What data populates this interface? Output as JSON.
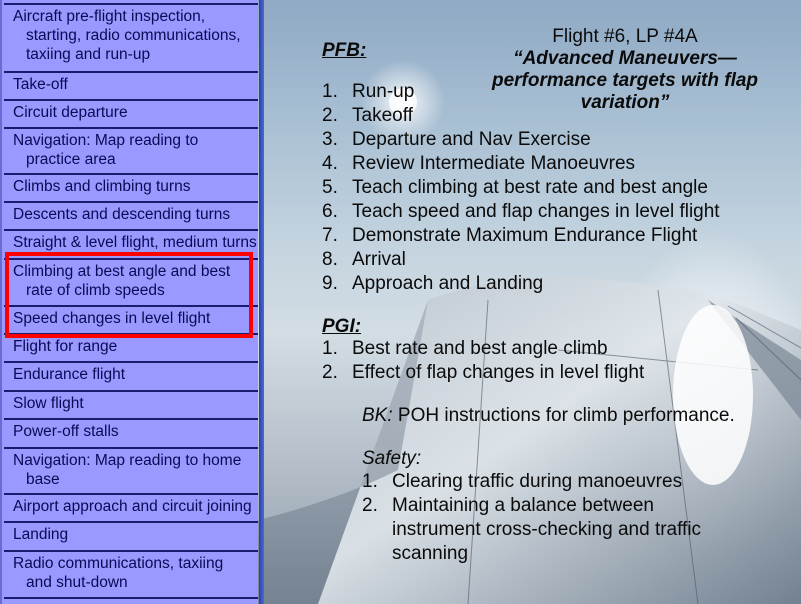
{
  "sidebar": {
    "items": [
      {
        "line1": "Aircraft pre-flight inspection,",
        "line2": "starting, radio communications,",
        "line3": "taxiing and run-up"
      },
      {
        "line1": "Take-off"
      },
      {
        "line1": "Circuit departure"
      },
      {
        "line1": "Navigation:  Map reading to",
        "line2": "practice area"
      },
      {
        "line1": "Climbs and climbing turns"
      },
      {
        "line1": "Descents and descending turns"
      },
      {
        "line1": "Straight & level flight, medium turns"
      },
      {
        "line1": "Climbing at best angle and best",
        "line2": "rate of climb speeds",
        "highlighted": true
      },
      {
        "line1": "Speed changes in level flight",
        "highlighted": true
      },
      {
        "line1": "Flight for range"
      },
      {
        "line1": "Endurance flight"
      },
      {
        "line1": "Slow flight"
      },
      {
        "line1": "Power-off stalls"
      },
      {
        "line1": "Navigation:  Map reading to home",
        "line2": "base"
      },
      {
        "line1": "Airport approach and circuit joining"
      },
      {
        "line1": "Landing"
      },
      {
        "line1": "Radio communications, taxiing",
        "line2": "and shut-down"
      }
    ],
    "highlight_color": "#ff0000",
    "background_color": "#9999ff"
  },
  "header": {
    "flight_id": "Flight #6,  LP #4A",
    "title_line1": "“Advanced  Maneuvers—",
    "title_line2": "performance targets with flap",
    "title_line3": "variation”"
  },
  "pfb": {
    "heading": "PFB:",
    "items": [
      {
        "num": "1.",
        "text": "Run-up"
      },
      {
        "num": "2.",
        "text": "Takeoff"
      },
      {
        "num": "3.",
        "text": "Departure and Nav Exercise"
      },
      {
        "num": "4.",
        "text": "Review Intermediate Manoeuvres"
      },
      {
        "num": "5.",
        "text": "Teach climbing at best rate and best angle"
      },
      {
        "num": "6.",
        "text": "Teach speed and flap changes in level flight"
      },
      {
        "num": "7.",
        "text": "Demonstrate Maximum Endurance Flight"
      },
      {
        "num": "8.",
        "text": "Arrival"
      },
      {
        "num": "9.",
        "text": "Approach and Landing"
      }
    ]
  },
  "pgi": {
    "heading": "PGI:",
    "items": [
      {
        "num": "1.",
        "text": "Best rate and best angle climb"
      },
      {
        "num": "2.",
        "text": "Effect of flap changes in level flight"
      }
    ]
  },
  "bk": {
    "label": "BK:",
    "text": " POH instructions for climb performance."
  },
  "safety": {
    "heading": "Safety:",
    "items": [
      {
        "num": "1.",
        "text": "Clearing traffic during manoeuvres"
      },
      {
        "num": "2.",
        "text": "Maintaining a balance between instrument cross-checking and traffic scanning"
      }
    ]
  }
}
